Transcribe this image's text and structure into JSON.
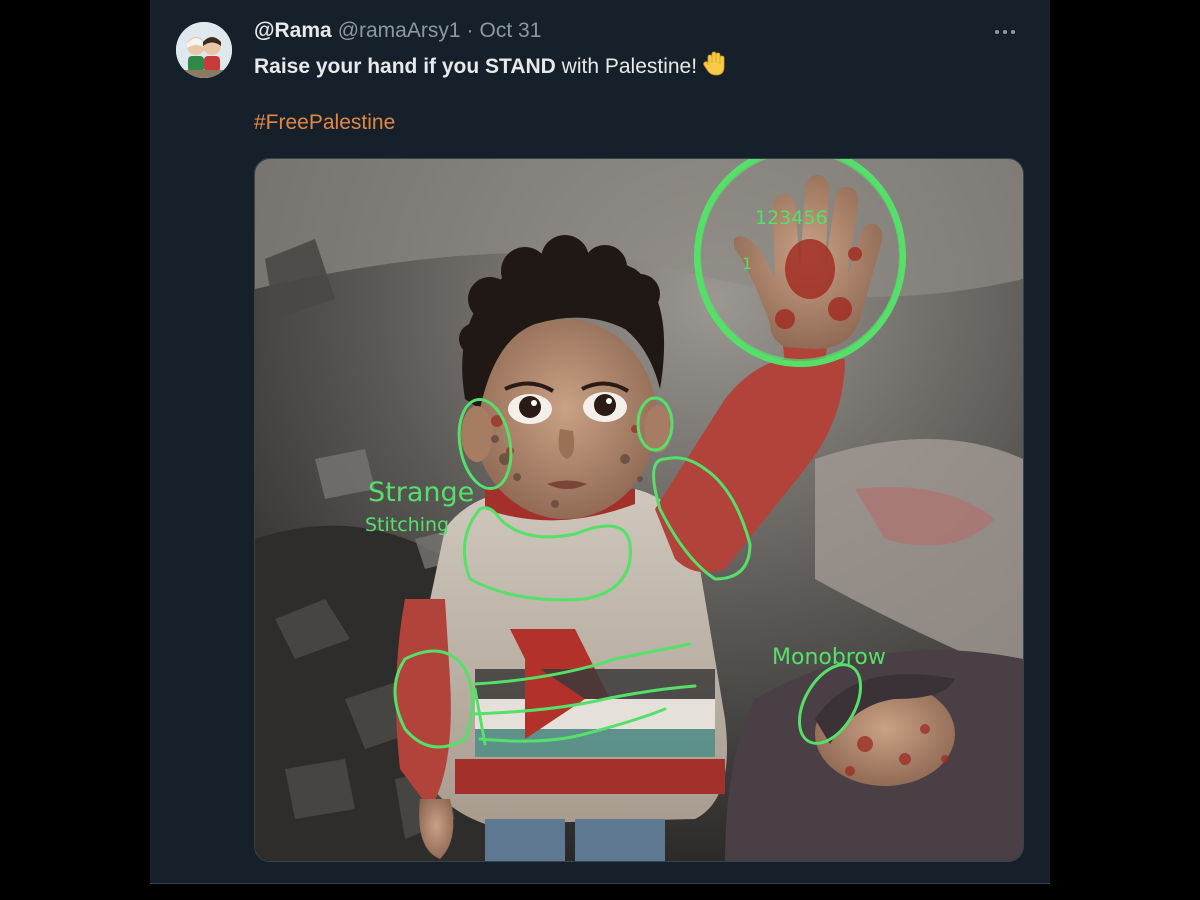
{
  "tweet": {
    "display_name": "@Rama",
    "handle": "@ramaArsy1",
    "separator": "·",
    "date": "Oct 31",
    "text_parts": {
      "bold_start": "Raise your hand if you STAND",
      "rest": " with Palestine!"
    },
    "hashtag": "#FreePalestine",
    "more_icon": "more-horizontal-icon",
    "emoji_icon": "raised-hand-icon"
  },
  "annotations": {
    "finger_numbers": "123456",
    "thumb_number": "1",
    "label_strange": "Strange",
    "label_stitching": "Stitching",
    "label_monobrow": "Monobrow"
  },
  "colors": {
    "background": "#15202b",
    "hashtag": "#e28743",
    "annotation": "#55e06a"
  }
}
